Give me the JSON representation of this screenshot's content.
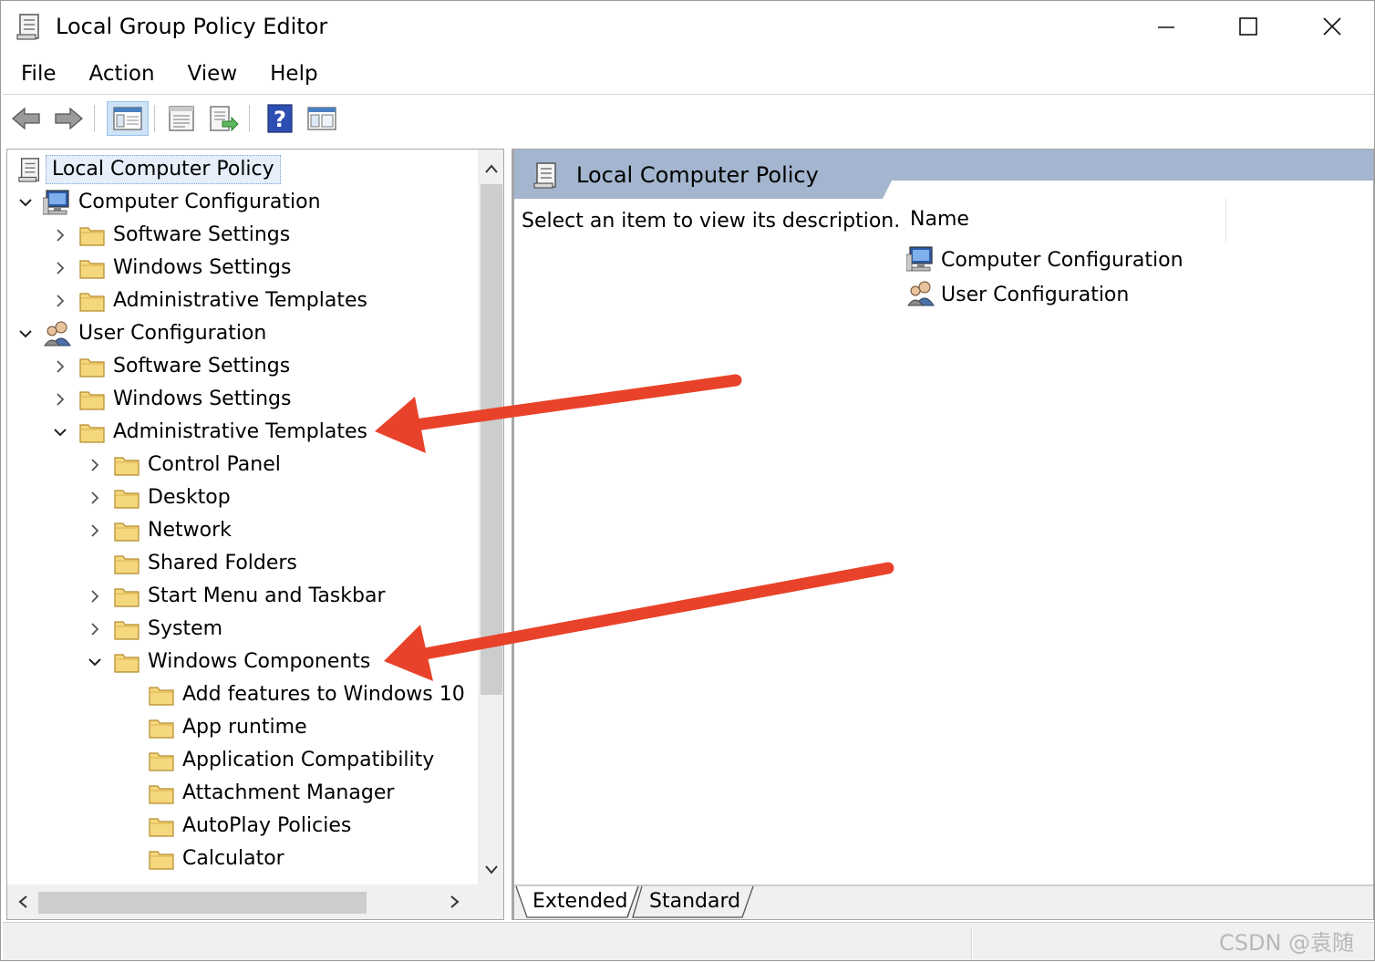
{
  "window": {
    "title": "Local Group Policy Editor",
    "controls": {
      "minimize": "minimize-icon",
      "maximize": "maximize-icon",
      "close": "close-icon"
    }
  },
  "menu": [
    "File",
    "Action",
    "View",
    "Help"
  ],
  "toolbar": {
    "buttons": [
      "back-arrow-icon",
      "forward-arrow-icon",
      "show-hide-tree-icon",
      "properties-icon",
      "export-list-icon",
      "help-icon",
      "filter-view-icon"
    ]
  },
  "tree": {
    "root": "Local Computer Policy",
    "computer_configuration": {
      "label": "Computer Configuration",
      "children": [
        "Software Settings",
        "Windows Settings",
        "Administrative Templates"
      ]
    },
    "user_configuration": {
      "label": "User Configuration",
      "children": [
        "Software Settings",
        "Windows Settings",
        "Administrative Templates"
      ],
      "admin_templates_children": [
        "Control Panel",
        "Desktop",
        "Network",
        "Shared Folders",
        "Start Menu and Taskbar",
        "System",
        "Windows Components"
      ],
      "windows_components_children": [
        "Add features to Windows 10",
        "App runtime",
        "Application Compatibility",
        "Attachment Manager",
        "AutoPlay Policies",
        "Calculator"
      ]
    }
  },
  "details": {
    "header": "Local Computer Policy",
    "description": "Select an item to view its description.",
    "column_name": "Name",
    "items": [
      "Computer Configuration",
      "User Configuration"
    ]
  },
  "tabs": [
    "Extended",
    "Standard"
  ],
  "statusbar": {
    "watermark": "CSDN @袁随"
  },
  "colors": {
    "arrow": "#e8432a",
    "header_band": "#a4b6cf",
    "folder": "#f5d77e",
    "selection": "#e5eef9"
  }
}
